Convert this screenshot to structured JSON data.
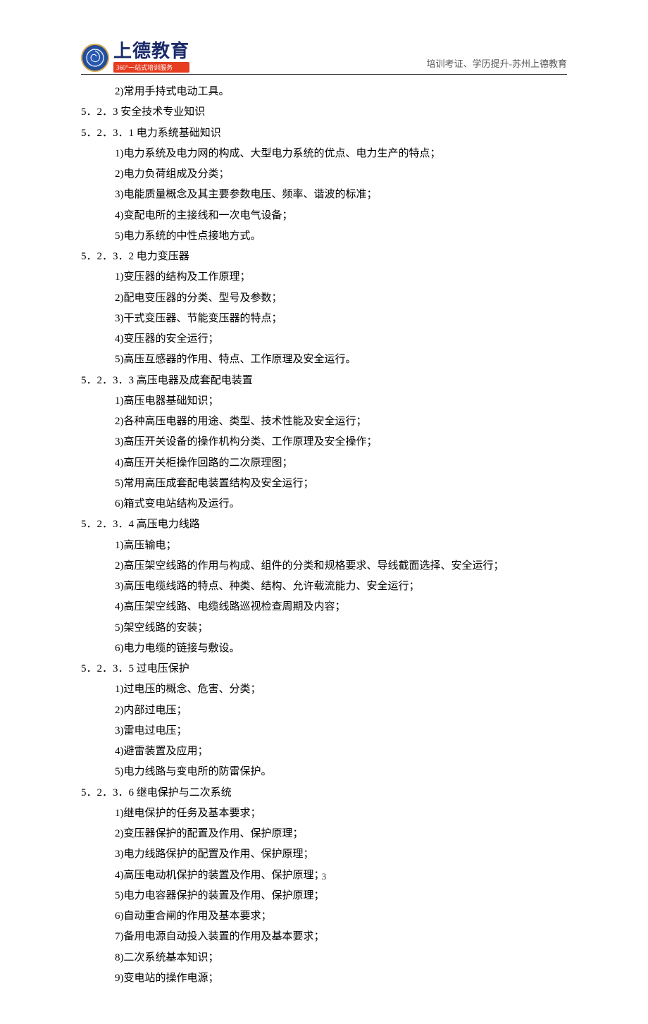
{
  "header": {
    "logo_symbol": "㊎",
    "logo_main": "上德教育",
    "logo_sub": "360°一站式培训服务",
    "right_text": "培训考证、学历提升-苏州上德教育"
  },
  "content": {
    "lines": [
      {
        "cls": "indent-1",
        "text": "2)常用手持式电动工具。"
      },
      {
        "cls": "heading-5",
        "text": "5．2．3 安全技术专业知识"
      },
      {
        "cls": "heading-6",
        "text": "5．2．3．1 电力系统基础知识"
      },
      {
        "cls": "indent-1",
        "text": "1)电力系统及电力网的构成、大型电力系统的优点、电力生产的特点；"
      },
      {
        "cls": "indent-1",
        "text": "2)电力负荷组成及分类；"
      },
      {
        "cls": "indent-1",
        "text": "3)电能质量概念及其主要参数电压、频率、谐波的标准；"
      },
      {
        "cls": "indent-1",
        "text": "4)变配电所的主接线和一次电气设备；"
      },
      {
        "cls": "indent-1",
        "text": "5)电力系统的中性点接地方式。"
      },
      {
        "cls": "heading-6",
        "text": "5．2．3．2 电力变压器"
      },
      {
        "cls": "indent-1",
        "text": "1)变压器的结构及工作原理；"
      },
      {
        "cls": "indent-1",
        "text": "2)配电变压器的分类、型号及参数；"
      },
      {
        "cls": "indent-1",
        "text": "3)干式变压器、节能变压器的特点；"
      },
      {
        "cls": "indent-1",
        "text": "4)变压器的安全运行；"
      },
      {
        "cls": "indent-1",
        "text": "5)高压互感器的作用、特点、工作原理及安全运行。"
      },
      {
        "cls": "heading-6",
        "text": "5．2．3．3 高压电器及成套配电装置"
      },
      {
        "cls": "indent-1",
        "text": "1)高压电器基础知识；"
      },
      {
        "cls": "indent-1",
        "text": "2)各种高压电器的用途、类型、技术性能及安全运行；"
      },
      {
        "cls": "indent-1",
        "text": "3)高压开关设备的操作机构分类、工作原理及安全操作；"
      },
      {
        "cls": "indent-1",
        "text": "4)高压开关柜操作回路的二次原理图；"
      },
      {
        "cls": "indent-1",
        "text": "5)常用高压成套配电装置结构及安全运行；"
      },
      {
        "cls": "indent-1",
        "text": "6)箱式变电站结构及运行。"
      },
      {
        "cls": "heading-6",
        "text": "5．2．3．4 高压电力线路"
      },
      {
        "cls": "indent-1",
        "text": "1)高压输电；"
      },
      {
        "cls": "indent-1",
        "text": "2)高压架空线路的作用与构成、组件的分类和规格要求、导线截面选择、安全运行；"
      },
      {
        "cls": "indent-1",
        "text": "3)高压电缆线路的特点、种类、结构、允许载流能力、安全运行；"
      },
      {
        "cls": "indent-1",
        "text": "4)高压架空线路、电缆线路巡视检查周期及内容；"
      },
      {
        "cls": "indent-1",
        "text": "5)架空线路的安装；"
      },
      {
        "cls": "indent-1",
        "text": "6)电力电缆的链接与敷设。"
      },
      {
        "cls": "heading-6",
        "text": "5．2．3．5 过电压保护"
      },
      {
        "cls": "indent-1",
        "text": "1)过电压的概念、危害、分类；"
      },
      {
        "cls": "indent-1",
        "text": "2)内部过电压；"
      },
      {
        "cls": "indent-1",
        "text": "3)雷电过电压；"
      },
      {
        "cls": "indent-1",
        "text": "4)避雷装置及应用；"
      },
      {
        "cls": "indent-1",
        "text": "5)电力线路与变电所的防雷保护。"
      },
      {
        "cls": "heading-6",
        "text": "5．2．3．6 继电保护与二次系统"
      },
      {
        "cls": "indent-1",
        "text": "1)继电保护的任务及基本要求；"
      },
      {
        "cls": "indent-1",
        "text": "2)变压器保护的配置及作用、保护原理；"
      },
      {
        "cls": "indent-1",
        "text": "3)电力线路保护的配置及作用、保护原理；"
      },
      {
        "cls": "indent-1",
        "text": "4)高压电动机保护的装置及作用、保护原理；"
      },
      {
        "cls": "indent-1",
        "text": "5)电力电容器保护的装置及作用、保护原理；"
      },
      {
        "cls": "indent-1",
        "text": "6)自动重合闸的作用及基本要求；"
      },
      {
        "cls": "indent-1",
        "text": "7)备用电源自动投入装置的作用及基本要求；"
      },
      {
        "cls": "indent-1",
        "text": "8)二次系统基本知识；"
      },
      {
        "cls": "indent-1",
        "text": "9)变电站的操作电源；"
      }
    ]
  },
  "footer": {
    "page_number": "3"
  }
}
